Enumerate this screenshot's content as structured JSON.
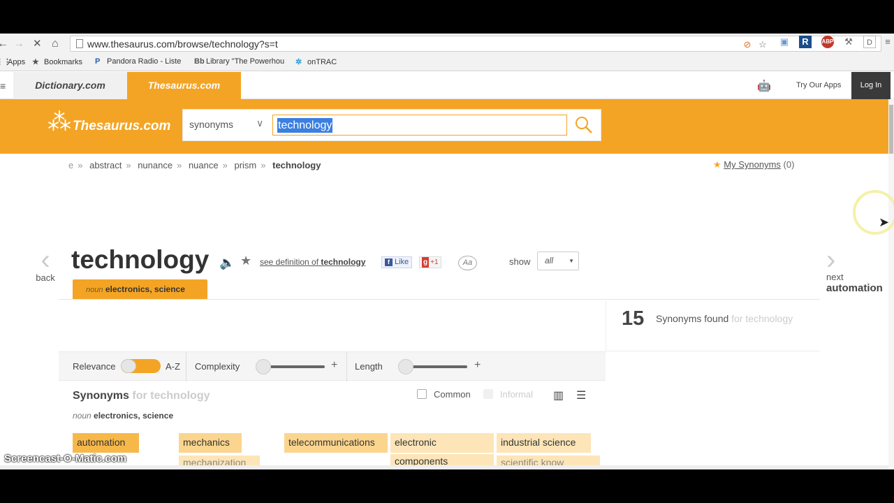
{
  "browser": {
    "url": "www.thesaurus.com/browse/technology?s=t",
    "bookmarks": [
      {
        "icon": "⋮⋮",
        "label": "Apps"
      },
      {
        "icon": "★",
        "label": "Bookmarks"
      },
      {
        "icon": "P",
        "label": "Pandora Radio - Liste"
      },
      {
        "icon": "Bb",
        "label": "Library \"The Powerhou"
      },
      {
        "icon": "✲",
        "label": "onTRAC"
      }
    ]
  },
  "site_nav": {
    "dictionary_tab": "Dictionary.com",
    "thesaurus_tab": "Thesaurus.com",
    "try_apps": "Try Our Apps",
    "login": "Log In"
  },
  "header": {
    "logo": "Thesaurus.com",
    "search_type": "synonyms",
    "search_value": "technology"
  },
  "breadcrumb": {
    "items": [
      "e",
      "abstract",
      "nunance",
      "nuance",
      "prism"
    ],
    "current": "technology"
  },
  "my_synonyms": {
    "label": "My Synonyms",
    "count": "(0)"
  },
  "navigation": {
    "back": "back",
    "next": "next",
    "next_word": "automation"
  },
  "entry": {
    "word": "technology",
    "see_definition_prefix": "see definition of",
    "see_definition_word": "technology",
    "like": "Like",
    "gplus": "+1",
    "font_toggle": "Aa",
    "show_label": "show",
    "show_value": "all",
    "pos_tab_pos": "noun",
    "pos_tab_sense": "electronics, science"
  },
  "results": {
    "count": "15",
    "found_label": "Synonyms found",
    "found_for": "for technology"
  },
  "filters": {
    "relevance": "Relevance",
    "az": "A-Z",
    "complexity": "Complexity",
    "length": "Length",
    "plus": "+"
  },
  "synonyms_section": {
    "heading": "Synonyms",
    "heading_for": "for technology",
    "common": "Common",
    "informal": "Informal",
    "pos": "noun",
    "sense": "electronics, science",
    "row1": [
      "automation",
      "mechanics",
      "telecommunications",
      "electronic",
      "industrial science"
    ],
    "row2": [
      "mechanization",
      "components",
      "scientific know"
    ]
  },
  "colors": {
    "brand_orange": "#f4a424",
    "syn_strong": "#f7b84a",
    "syn_medium": "#fbd58e",
    "syn_light": "#fde5b8"
  },
  "watermark": "Screencast-O-Matic.com"
}
